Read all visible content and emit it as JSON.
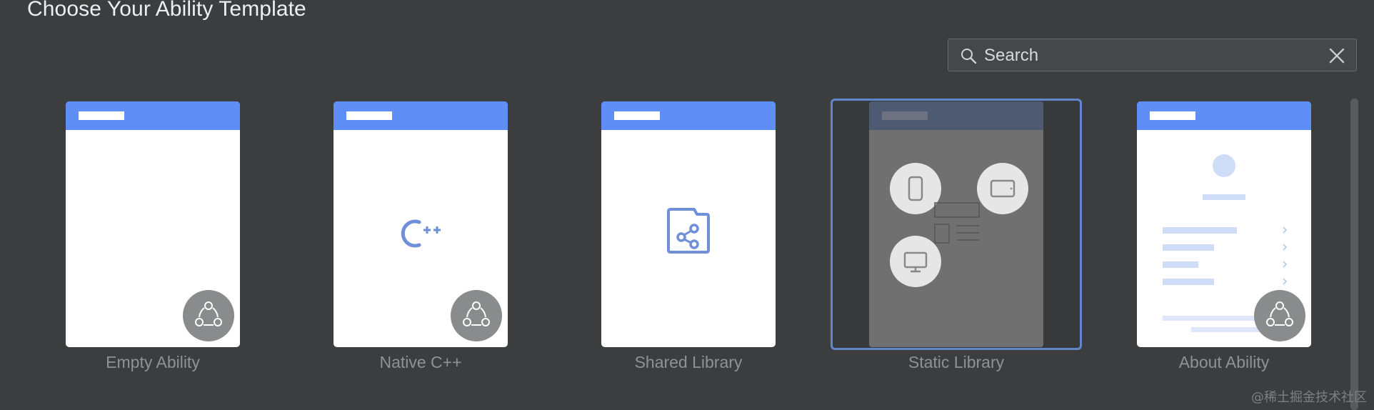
{
  "dialog": {
    "title": "Choose Your Ability Template"
  },
  "search": {
    "placeholder": "Search",
    "value": ""
  },
  "templates": [
    {
      "label": "Empty Ability"
    },
    {
      "label": "Native C++"
    },
    {
      "label": "Shared Library"
    },
    {
      "label": "Static Library",
      "selected": true
    },
    {
      "label": "About Ability"
    }
  ],
  "watermark": "@稀土掘金技术社区",
  "colors": {
    "accent": "#5f8ef6",
    "selection": "#5f87c9",
    "background": "#3c3d3f"
  },
  "icons": [
    "search-icon",
    "close-icon",
    "cpp-icon",
    "share-file-icon",
    "phone-icon",
    "tablet-icon",
    "monitor-icon",
    "harmony-badge-icon",
    "chevron-right-icon"
  ]
}
